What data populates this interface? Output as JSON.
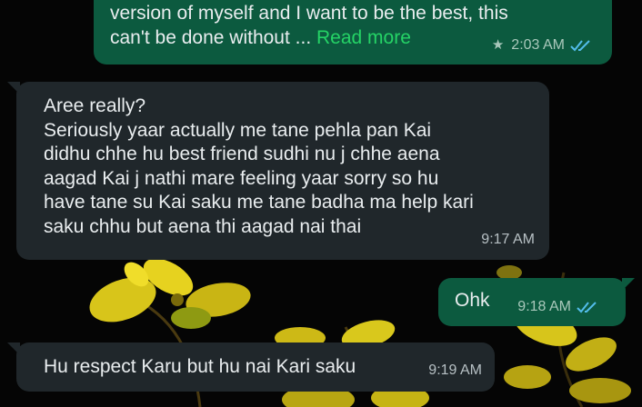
{
  "wallpaper": {
    "description_icon": "yellow-flowers-wallpaper"
  },
  "messages": [
    {
      "direction": "outgoing",
      "text": "version of myself and I want to be the best, this\ncan't be done without ... ",
      "read_more": "Read more",
      "time": "2:03 AM",
      "starred": true,
      "status": "read"
    },
    {
      "direction": "incoming",
      "text": "Aree really?\nSeriously yaar actually me tane pehla pan Kai\ndidhu chhe hu best friend sudhi nu j chhe aena\naagad Kai j nathi mare feeling yaar sorry so hu\nhave tane su Kai saku me tane badha ma help kari\nsaku chhu but aena thi aagad nai thai",
      "time": "9:17 AM"
    },
    {
      "direction": "outgoing",
      "text": "Ohk",
      "time": "9:18 AM",
      "status": "read"
    },
    {
      "direction": "incoming",
      "text": "Hu respect Karu but hu nai Kari saku",
      "time": "9:19 AM"
    }
  ],
  "colors": {
    "outgoing_bubble": "#0c5a3f",
    "incoming_bubble": "#20272b",
    "read_more": "#25d366",
    "read_ticks": "#53bdeb"
  }
}
